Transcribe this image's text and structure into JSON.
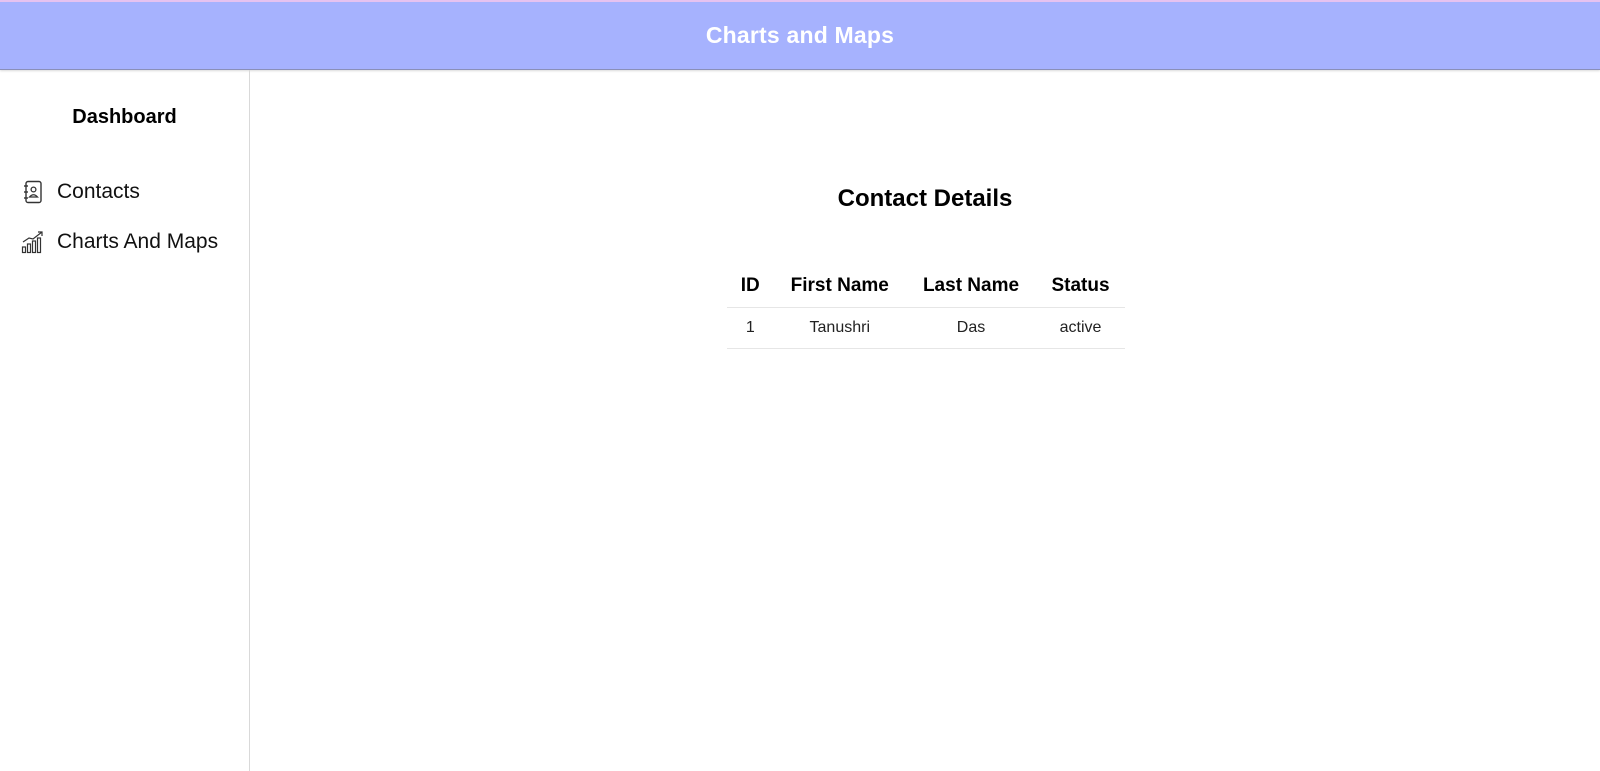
{
  "header": {
    "title": "Charts and Maps"
  },
  "sidebar": {
    "title": "Dashboard",
    "items": [
      {
        "label": "Contacts",
        "icon": "contacts-book-icon"
      },
      {
        "label": "Charts And Maps",
        "icon": "chart-growth-icon"
      }
    ]
  },
  "main": {
    "title": "Contact Details",
    "table": {
      "headers": [
        "ID",
        "First Name",
        "Last Name",
        "Status"
      ],
      "rows": [
        [
          "1",
          "Tanushri",
          "Das",
          "active"
        ]
      ]
    }
  },
  "colors": {
    "header_bg": "#a6b2fe",
    "header_text": "#ffffff"
  }
}
